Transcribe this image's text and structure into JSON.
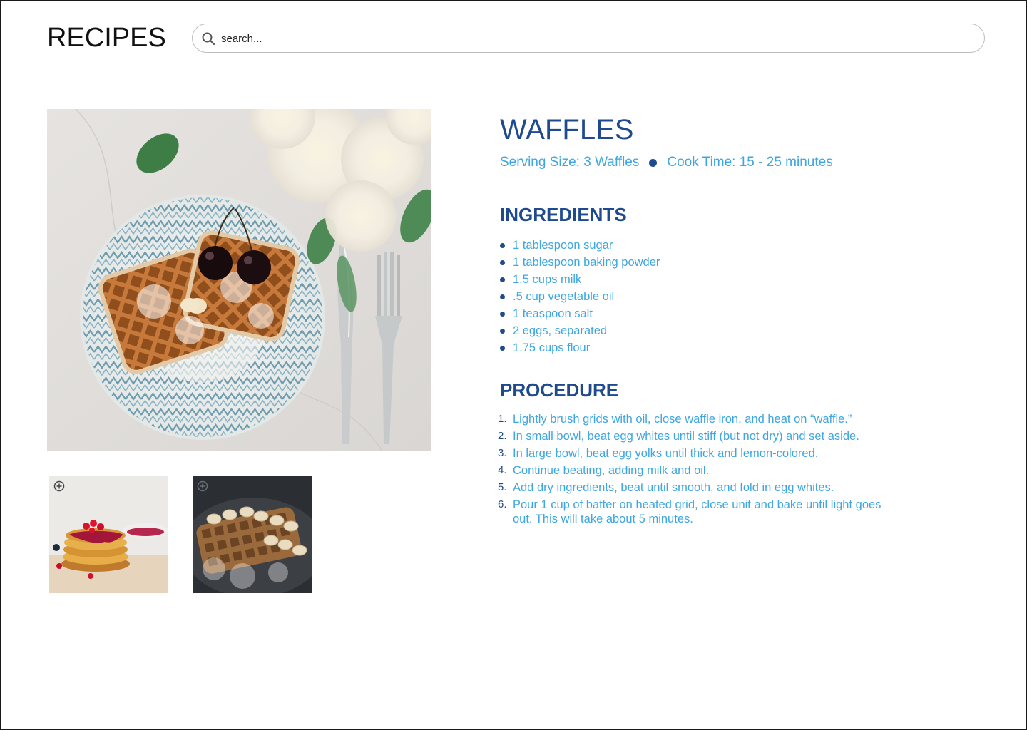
{
  "header": {
    "logo": "RECIPES",
    "search": {
      "placeholder": "search...",
      "value": "",
      "icon": "search-icon"
    }
  },
  "gallery": {
    "hero_alt": "Waffles on a patterned plate with cherries",
    "thumbnails": [
      {
        "alt": "Stack of pancakes with berries",
        "icon": "zoom-in-icon"
      },
      {
        "alt": "Waffles with bananas",
        "icon": "zoom-in-icon"
      }
    ]
  },
  "recipe": {
    "title": "WAFFLES",
    "serving": "Serving Size: 3 Waffles",
    "cook_time": "Cook Time: 15 - 25 minutes",
    "ingredients_heading": "INGREDIENTS",
    "ingredients": [
      "1 tablespoon sugar",
      "1 tablespoon baking powder",
      "1.5 cups milk",
      ".5 cup vegetable oil",
      "1 teaspoon salt",
      "2 eggs, separated",
      "1.75 cups flour"
    ],
    "procedure_heading": "PROCEDURE",
    "procedure": [
      {
        "num": "1.",
        "text": "Lightly brush grids with oil, close waffle iron, and heat on “waffle.”"
      },
      {
        "num": "2.",
        "text": "In small bowl, beat egg whites until stiff (but not dry) and set aside."
      },
      {
        "num": "3.",
        "text": "In large bowl, beat egg yolks until thick and lemon-colored."
      },
      {
        "num": "4.",
        "text": "Continue beating, adding milk and oil."
      },
      {
        "num": "5.",
        "text": "Add dry ingredients, beat until smooth, and fold in egg whites."
      },
      {
        "num": "6.",
        "text": "Pour 1 cup of batter on heated grid, close unit and bake until light goes out. This will take about 5 minutes."
      }
    ]
  },
  "colors": {
    "heading": "#1f4a8e",
    "text": "#3ea6e0",
    "border": "#bdbdbd"
  }
}
